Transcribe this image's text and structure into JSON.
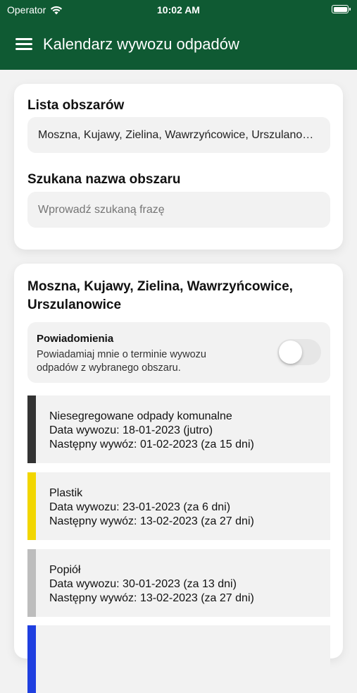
{
  "status_bar": {
    "carrier": "Operator",
    "time": "10:02 AM"
  },
  "app_bar": {
    "title": "Kalendarz wywozu odpadów"
  },
  "filters": {
    "areas_label": "Lista obszarów",
    "areas_value": "Moszna, Kujawy, Zielina, Wawrzyńcowice, Urszulanowice",
    "search_label": "Szukana nazwa obszaru",
    "search_placeholder": "Wprowadź szukaną frazę"
  },
  "area": {
    "title": "Moszna, Kujawy, Zielina, Wawrzyńcowice, Urszulanowice",
    "notifications": {
      "title": "Powiadomienia",
      "description": "Powiadamiaj mnie o terminie wywozu odpadów z wybranego obszaru.",
      "enabled": false
    },
    "waste_types": [
      {
        "name": "Niesegregowane odpady komunalne",
        "date": "Data wywozu: 18-01-2023 (jutro)",
        "next": "Następny wywóz: 01-02-2023 (za 15 dni)",
        "color": "#333333"
      },
      {
        "name": "Plastik",
        "date": "Data wywozu: 23-01-2023 (za 6 dni)",
        "next": "Następny wywóz: 13-02-2023 (za 27 dni)",
        "color": "#f2d600"
      },
      {
        "name": "Popiół",
        "date": "Data wywozu: 30-01-2023 (za 13 dni)",
        "next": "Następny wywóz: 13-02-2023 (za 27 dni)",
        "color": "#bdbdbd"
      },
      {
        "name": "",
        "date": "",
        "next": "",
        "color": "#1f3fe0"
      }
    ]
  },
  "colors": {
    "primary": "#0f5a33"
  }
}
